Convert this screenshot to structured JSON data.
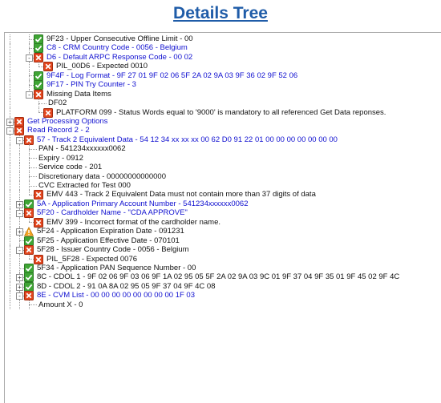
{
  "heading": "Details Tree",
  "rows": [
    {
      "d": 2,
      "exp": null,
      "icon": "check",
      "color": "black",
      "text": "9F23 - Upper Consecutive Offline Limit - 00"
    },
    {
      "d": 2,
      "exp": null,
      "icon": "check",
      "color": "blue",
      "text": "C8 - CRM Country Code - 0056 - Belgium"
    },
    {
      "d": 2,
      "exp": "-",
      "icon": "error",
      "color": "blue",
      "text": "D6 - Default ARPC Response Code - 00 02"
    },
    {
      "d": 3,
      "exp": null,
      "icon": "error",
      "color": "black",
      "text": "PIL_00D6 - Expected 0010"
    },
    {
      "d": 2,
      "exp": null,
      "icon": "check",
      "color": "blue",
      "text": "9F4F - Log Format - 9F 27 01 9F 02 06 5F 2A 02 9A 03 9F 36 02 9F 52 06"
    },
    {
      "d": 2,
      "exp": null,
      "icon": "check",
      "color": "blue",
      "text": "9F17 - PIN Try Counter - 3"
    },
    {
      "d": 2,
      "exp": "-",
      "icon": "error",
      "color": "black",
      "text": "Missing Data Items"
    },
    {
      "d": 3,
      "exp": null,
      "icon": "none",
      "color": "black",
      "text": "DF02"
    },
    {
      "d": 3,
      "exp": null,
      "icon": "error",
      "color": "black",
      "text": "PLATFORM 099 - Status Words equal to '9000' is mandatory to all referenced Get Data reponses."
    },
    {
      "d": 0,
      "exp": "+",
      "icon": "error",
      "color": "blue",
      "text": "Get Processing Options"
    },
    {
      "d": 0,
      "exp": "-",
      "icon": "error",
      "color": "blue",
      "text": "Read Record 2 - 2"
    },
    {
      "d": 1,
      "exp": "-",
      "icon": "error",
      "color": "blue",
      "text": "57 - Track 2 Equivalent Data - 54 12 34 xx xx xx 00 62 D0 91 22 01 00 00 00 00 00 00 00"
    },
    {
      "d": 2,
      "exp": null,
      "icon": "none",
      "color": "black",
      "text": "PAN - 541234xxxxxx0062"
    },
    {
      "d": 2,
      "exp": null,
      "icon": "none",
      "color": "black",
      "text": "Expiry - 0912"
    },
    {
      "d": 2,
      "exp": null,
      "icon": "none",
      "color": "black",
      "text": "Service code - 201"
    },
    {
      "d": 2,
      "exp": null,
      "icon": "none",
      "color": "black",
      "text": "Discretionary data - 00000000000000"
    },
    {
      "d": 2,
      "exp": null,
      "icon": "none",
      "color": "black",
      "text": "CVC Extracted for Test 000"
    },
    {
      "d": 2,
      "exp": null,
      "icon": "error",
      "color": "black",
      "text": "EMV 443 - Track 2 Equivalent Data must not contain more than 37 digits of data"
    },
    {
      "d": 1,
      "exp": "+",
      "icon": "check",
      "color": "blue",
      "text": "5A - Application Primary Account Number - 541234xxxxxx0062"
    },
    {
      "d": 1,
      "exp": "-",
      "icon": "error",
      "color": "blue",
      "text": "5F20 - Cardholder Name - \"CDA APPROVE\""
    },
    {
      "d": 2,
      "exp": null,
      "icon": "error",
      "color": "black",
      "text": "EMV 399 - Incorrect format of the cardholder name."
    },
    {
      "d": 1,
      "exp": "+",
      "icon": "warn",
      "color": "black",
      "text": "5F24 - Application Expiration Date - 091231"
    },
    {
      "d": 1,
      "exp": null,
      "icon": "check",
      "color": "black",
      "text": "5F25 - Application Effective Date - 070101"
    },
    {
      "d": 1,
      "exp": "-",
      "icon": "error",
      "color": "black",
      "text": "5F28 - Issuer Country Code - 0056 - Belgium"
    },
    {
      "d": 2,
      "exp": null,
      "icon": "error",
      "color": "black",
      "text": "PIL_5F28 - Expected 0076"
    },
    {
      "d": 1,
      "exp": null,
      "icon": "check",
      "color": "black",
      "text": "5F34 - Application PAN Sequence Number - 00"
    },
    {
      "d": 1,
      "exp": "+",
      "icon": "check",
      "color": "black",
      "text": "8C - CDOL 1 - 9F 02 06 9F 03 06 9F 1A 02 95 05 5F 2A 02 9A 03 9C 01 9F 37 04 9F 35 01 9F 45 02 9F 4C"
    },
    {
      "d": 1,
      "exp": "+",
      "icon": "check",
      "color": "black",
      "text": "8D - CDOL 2 - 91 0A 8A 02 95 05 9F 37 04 9F 4C 08"
    },
    {
      "d": 1,
      "exp": "-",
      "icon": "error",
      "color": "blue",
      "text": "8E - CVM List - 00 00 00 00 00 00 00 00 1F 03"
    },
    {
      "d": 2,
      "exp": null,
      "icon": "none",
      "color": "black",
      "text": "Amount X - 0"
    }
  ]
}
